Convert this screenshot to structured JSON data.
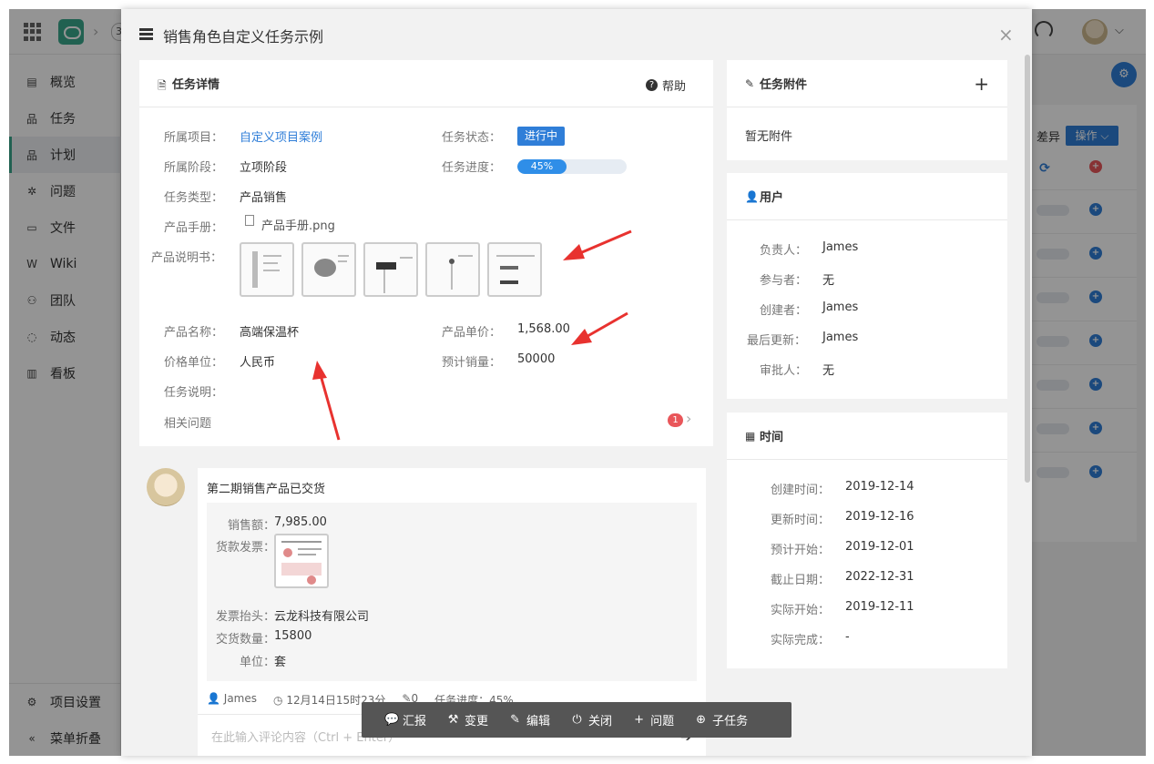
{
  "app": {
    "breadcrumb_num": "3",
    "sidebar": [
      {
        "icon": "overview-icon",
        "label": "概览"
      },
      {
        "icon": "task-icon",
        "label": "任务"
      },
      {
        "icon": "plan-icon",
        "label": "计划"
      },
      {
        "icon": "bug-icon",
        "label": "问题"
      },
      {
        "icon": "folder-icon",
        "label": "文件"
      },
      {
        "icon": "wiki-icon",
        "label": "Wiki"
      },
      {
        "icon": "team-icon",
        "label": "团队"
      },
      {
        "icon": "activity-icon",
        "label": "动态"
      },
      {
        "icon": "board-icon",
        "label": "看板"
      }
    ],
    "sidebar_bottom": [
      "项目设置",
      "菜单折叠"
    ],
    "bg_diff_label": "差异",
    "bg_op_button": "操作"
  },
  "modal": {
    "title": "销售角色自定义任务示例",
    "close": "×"
  },
  "detail": {
    "title": "任务详情",
    "help": "帮助",
    "project_label": "所属项目：",
    "project_value": "自定义项目案例",
    "stage_label": "所属阶段：",
    "stage_value": "立项阶段",
    "type_label": "任务类型：",
    "type_value": "产品销售",
    "manual_label": "产品手册：",
    "manual_value": "产品手册.png",
    "spec_label": "产品说明书：",
    "status_label": "任务状态：",
    "status_value": "进行中",
    "progress_label": "任务进度：",
    "progress_value": "45%",
    "progress_fraction": 0.45,
    "name_label": "产品名称：",
    "name_value": "高端保温杯",
    "unit_price_label": "产品单价：",
    "unit_price_value": "1,568.00",
    "currency_label": "价格单位：",
    "currency_value": "人民币",
    "sales_label": "预计销量：",
    "sales_value": "50000",
    "desc_label": "任务说明：",
    "related": "相关问题",
    "related_count": "1"
  },
  "attachments": {
    "title": "任务附件",
    "add": "+",
    "empty": "暂无附件"
  },
  "users": {
    "title": "用户",
    "owner_label": "负责人：",
    "owner": "James",
    "participants_label": "参与者：",
    "participants": "无",
    "creator_label": "创建者：",
    "creator": "James",
    "updater_label": "最后更新：",
    "updater": "James",
    "approver_label": "审批人：",
    "approver": "无"
  },
  "time": {
    "title": "时间",
    "created_label": "创建时间：",
    "created": "2019-12-14",
    "updated_label": "更新时间：",
    "updated": "2019-12-16",
    "planned_start_label": "预计开始：",
    "planned_start": "2019-12-01",
    "deadline_label": "截止日期：",
    "deadline": "2022-12-31",
    "actual_start_label": "实际开始：",
    "actual_start": "2019-12-11",
    "actual_end_label": "实际完成：",
    "actual_end": "-"
  },
  "comment": {
    "title": "第二期销售产品已交货",
    "sales_label": "销售额：",
    "sales": "7,985.00",
    "invoice_label": "货款发票：",
    "invoice_title_label": "发票抬头：",
    "invoice_title": "云龙科技有限公司",
    "qty_label": "交货数量：",
    "qty": "15800",
    "unit_label": "单位：",
    "unit": "套",
    "author": "James",
    "time": "12月14日15时23分",
    "attach_count": "0",
    "progress_text": "任务进度：45%",
    "input_placeholder": "在此输入评论内容（Ctrl + Enter）"
  },
  "toolbar": {
    "report": "汇报",
    "change": "变更",
    "edit": "编辑",
    "close": "关闭",
    "issue": "问题",
    "subtask": "子任务"
  },
  "colors": {
    "accent": "#2f7ed8",
    "brand": "#3aa78c",
    "badge": "#e9565a",
    "arrow": "#e8322f"
  }
}
